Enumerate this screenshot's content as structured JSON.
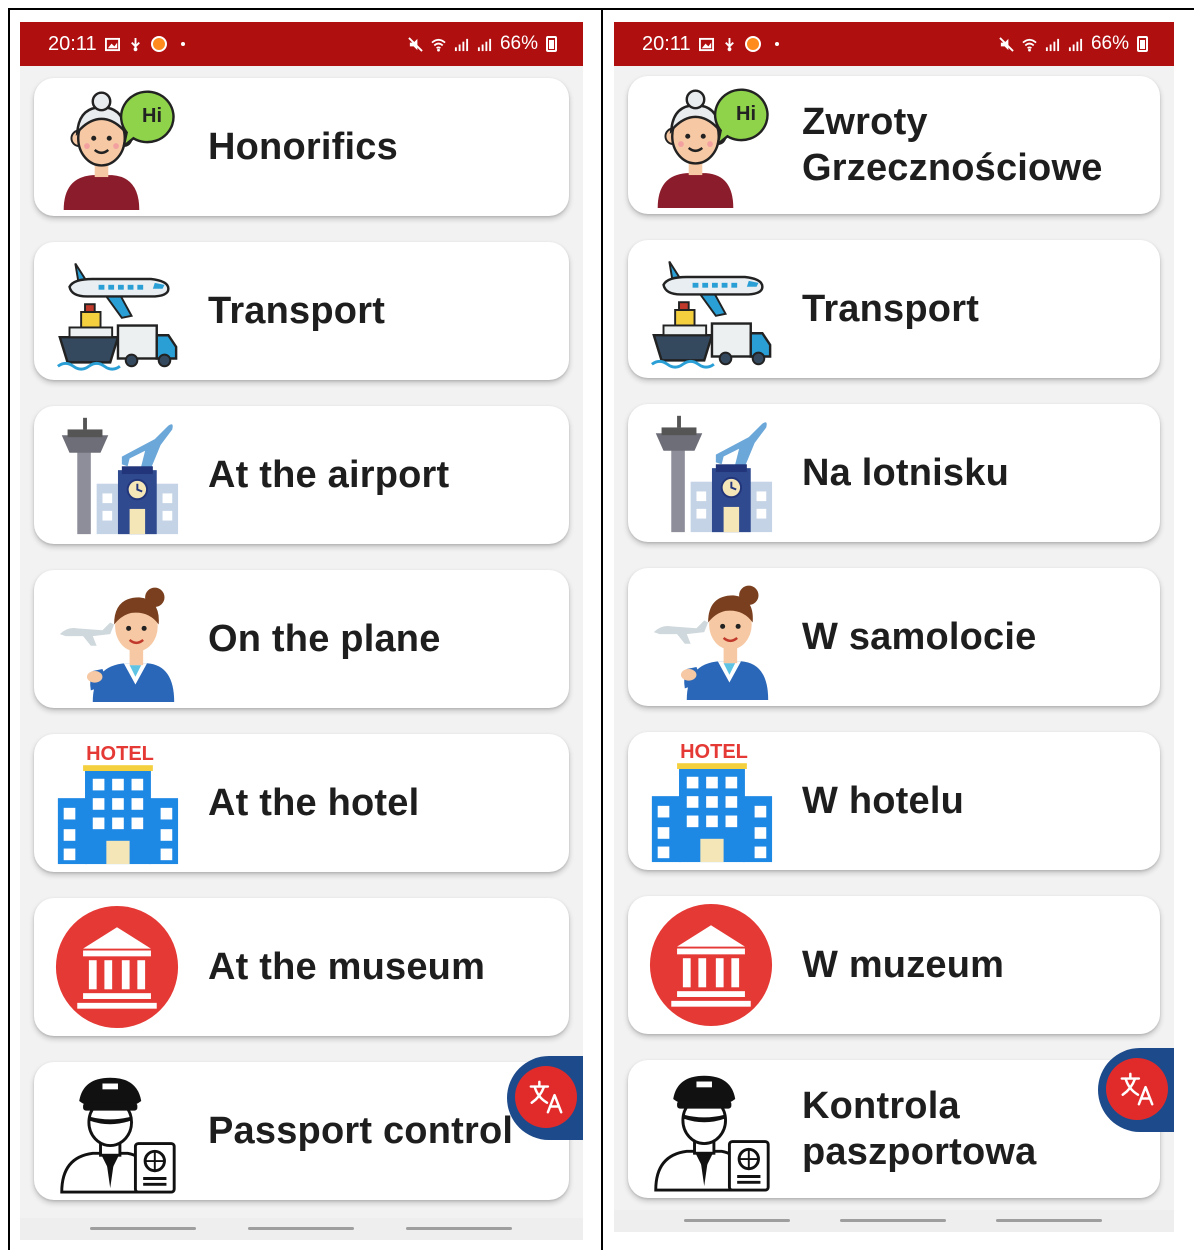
{
  "status_bar": {
    "time": "20:11",
    "battery": "66%",
    "color": "#b00f10"
  },
  "screens": [
    {
      "language": "English",
      "categories": [
        {
          "label": "Honorifics",
          "icon": "greeting-woman-icon"
        },
        {
          "label": "Transport",
          "icon": "transport-icon"
        },
        {
          "label": "At the airport",
          "icon": "airport-icon"
        },
        {
          "label": "On the plane",
          "icon": "flight-attendant-icon"
        },
        {
          "label": "At the hotel",
          "icon": "hotel-icon"
        },
        {
          "label": "At the museum",
          "icon": "museum-icon"
        },
        {
          "label": "Passport control",
          "icon": "passport-officer-icon"
        }
      ]
    },
    {
      "language": "Polish",
      "categories": [
        {
          "label": "Zwroty Grzecznościowe",
          "icon": "greeting-woman-icon"
        },
        {
          "label": "Transport",
          "icon": "transport-icon"
        },
        {
          "label": "Na lotnisku",
          "icon": "airport-icon"
        },
        {
          "label": "W samolocie",
          "icon": "flight-attendant-icon"
        },
        {
          "label": "W hotelu",
          "icon": "hotel-icon"
        },
        {
          "label": "W muzeum",
          "icon": "museum-icon"
        },
        {
          "label": "Kontrola paszportowa",
          "icon": "passport-officer-icon"
        }
      ]
    }
  ],
  "hi_bubble": "Hi",
  "hotel_sign": "HOTEL",
  "translate_button": {
    "icon": "translate-icon",
    "color": "#e12b2b"
  }
}
